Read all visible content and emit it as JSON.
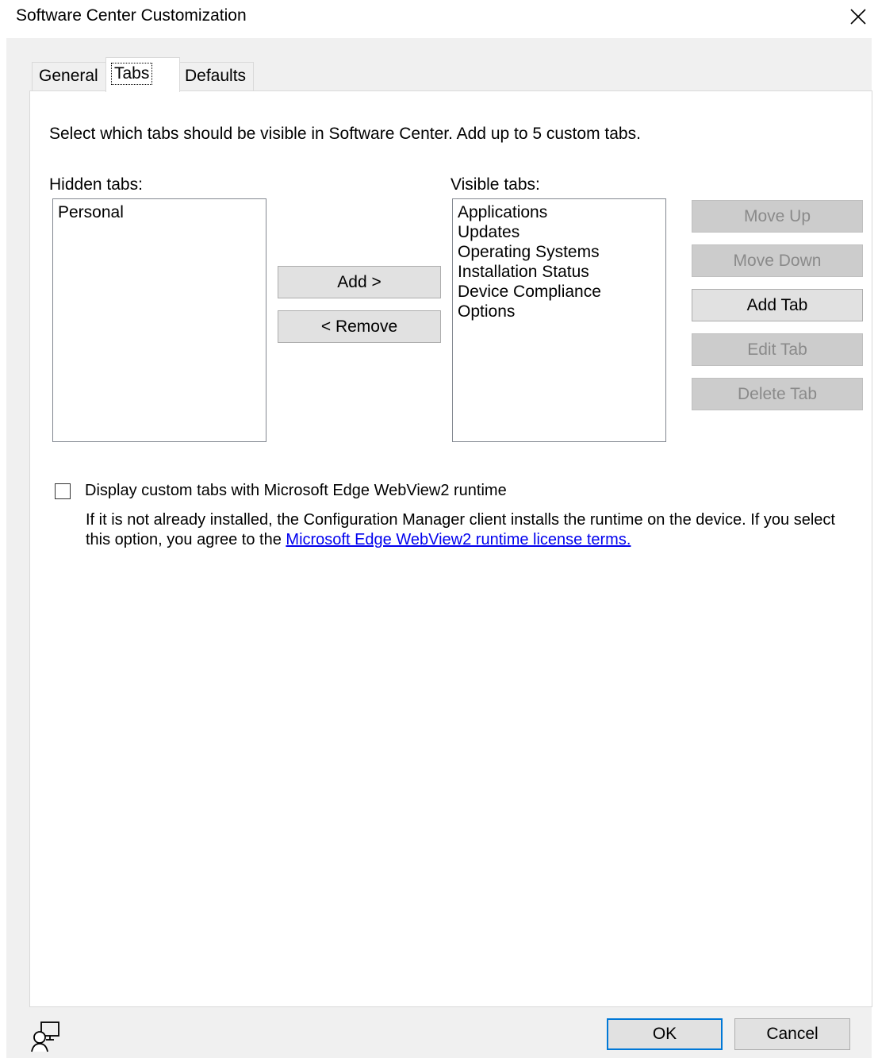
{
  "window": {
    "title": "Software Center Customization",
    "close_icon": "close-icon"
  },
  "tabs": [
    {
      "label": "General"
    },
    {
      "label": "Tabs",
      "selected": true
    },
    {
      "label": "Defaults"
    }
  ],
  "instructions": "Select which tabs should be visible in Software Center. Add up to 5 custom tabs.",
  "hidden_tabs": {
    "label": "Hidden tabs:",
    "items": [
      "Personal"
    ]
  },
  "visible_tabs": {
    "label": "Visible tabs:",
    "items": [
      "Applications",
      "Updates",
      "Operating Systems",
      "Installation Status",
      "Device Compliance",
      "Options"
    ]
  },
  "transfer_buttons": {
    "add": "Add >",
    "remove": "< Remove"
  },
  "side_buttons": {
    "move_up": "Move Up",
    "move_down": "Move Down",
    "add_tab": "Add Tab",
    "edit_tab": "Edit Tab",
    "delete_tab": "Delete Tab"
  },
  "webview": {
    "checkbox_label": "Display custom tabs with Microsoft Edge WebView2 runtime",
    "checked": false,
    "note_text": "If it is not already installed, the Configuration Manager client installs the runtime on the device. If you select this option, you agree to the ",
    "link_text": "Microsoft Edge WebView2 runtime license terms."
  },
  "footer": {
    "icon": "user-screen-icon",
    "ok": "OK",
    "cancel": "Cancel"
  },
  "colors": {
    "dialog_background": "#f0f0f0",
    "panel_background": "#ffffff",
    "accent": "#0078d7",
    "link": "#0000ee",
    "disabled_text": "#8a8a8a"
  }
}
